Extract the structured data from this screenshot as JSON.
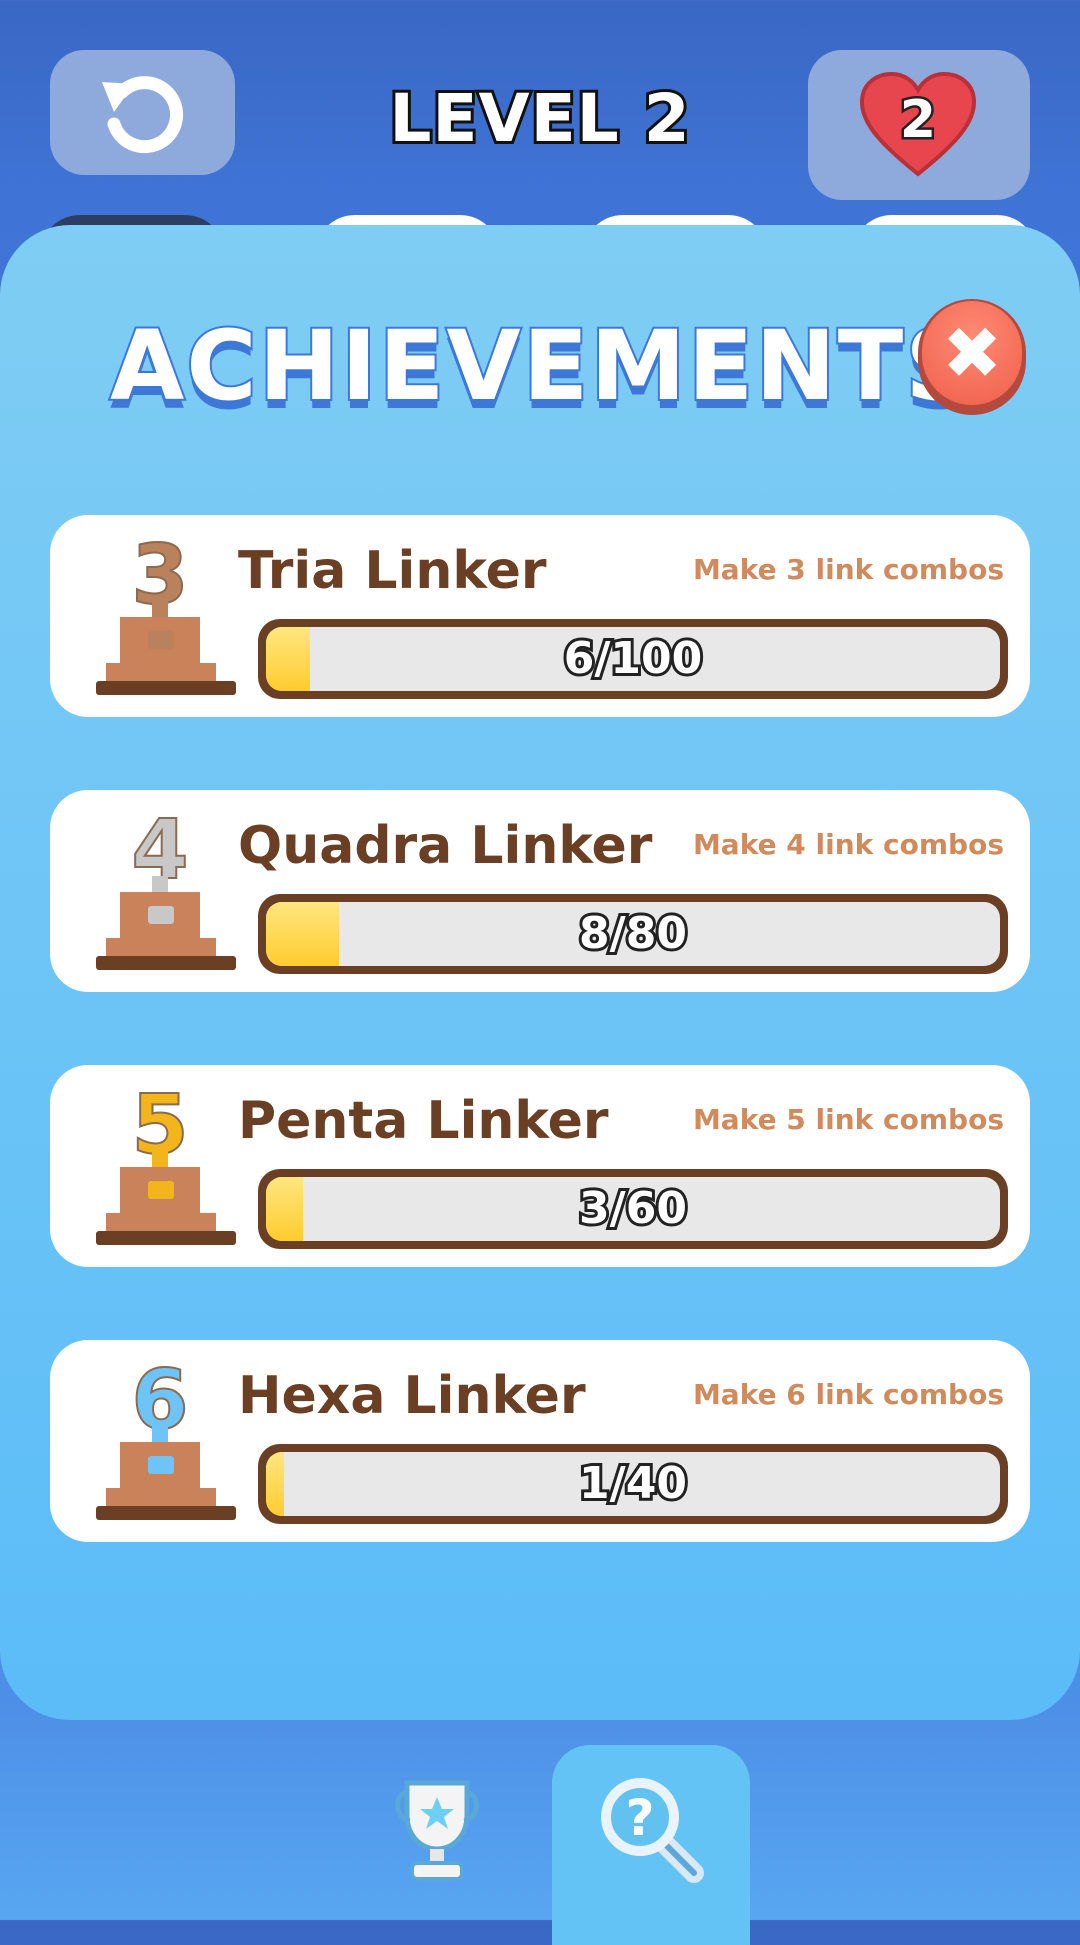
{
  "header": {
    "level_title": "LEVEL 2",
    "lives": "2"
  },
  "panel": {
    "title": "ACHIEVEMENTS",
    "close_glyph": "✖"
  },
  "achievements": [
    {
      "name": "Tria Linker",
      "description": "Make 3 link combos",
      "progress_text": "6/100",
      "current": 6,
      "total": 100,
      "trophy_number": "3",
      "trophy_color": "#b9825d"
    },
    {
      "name": "Quadra Linker",
      "description": "Make 4 link combos",
      "progress_text": "8/80",
      "current": 8,
      "total": 80,
      "trophy_number": "4",
      "trophy_color": "#c8c8c8"
    },
    {
      "name": "Penta Linker",
      "description": "Make 5 link combos",
      "progress_text": "3/60",
      "current": 3,
      "total": 60,
      "trophy_number": "5",
      "trophy_color": "#f2b61c"
    },
    {
      "name": "Hexa Linker",
      "description": "Make 6 link combos",
      "progress_text": "1/40",
      "current": 1,
      "total": 40,
      "trophy_number": "6",
      "trophy_color": "#6ec3f7"
    }
  ],
  "nav": {
    "items": [
      {
        "icon": "trophy-icon",
        "active": false
      },
      {
        "icon": "magnifier-question-icon",
        "active": true
      }
    ]
  },
  "colors": {
    "brown": "#6a3f24",
    "desc": "#d08a5b",
    "fill": "#ffcc2f",
    "close": "#ee5e4a"
  }
}
